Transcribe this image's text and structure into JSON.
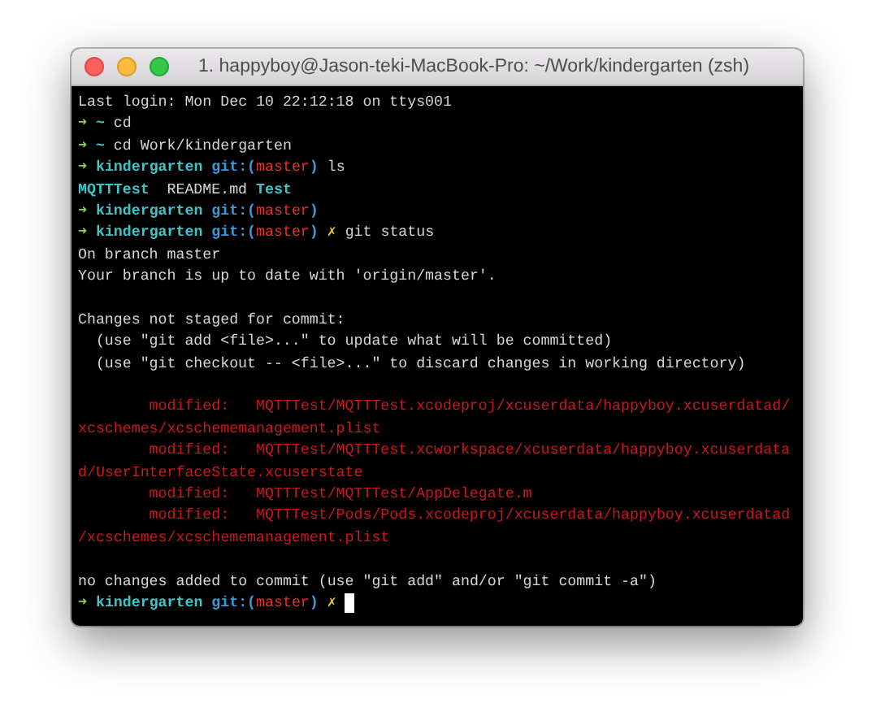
{
  "window": {
    "title": "1. happyboy@Jason-teki-MacBook-Pro: ~/Work/kindergarten (zsh)"
  },
  "lines": [
    {
      "kind": "text",
      "segments": [
        {
          "kind": "plain",
          "text": "Last login: Mon Dec 10 22:12:18 on ttys001"
        }
      ]
    },
    {
      "kind": "text",
      "segments": [
        {
          "kind": "arrow",
          "text": "➜"
        },
        {
          "kind": "cwd",
          "text": "~"
        },
        {
          "kind": "plain",
          "text": "cd"
        }
      ]
    },
    {
      "kind": "text",
      "segments": [
        {
          "kind": "arrow",
          "text": "➜"
        },
        {
          "kind": "cwd",
          "text": "~"
        },
        {
          "kind": "plain",
          "text": "cd Work/kindergarten"
        }
      ]
    },
    {
      "kind": "text",
      "segments": [
        {
          "kind": "arrow",
          "text": "➜"
        },
        {
          "kind": "cwd",
          "text": "kindergarten"
        },
        {
          "kind": "git",
          "text": "git:("
        },
        {
          "kind": "branch",
          "text": "master"
        },
        {
          "kind": "git-close",
          "text": ")"
        },
        {
          "kind": "plain",
          "text": "ls"
        }
      ]
    },
    {
      "kind": "text",
      "segments": [
        {
          "kind": "dir",
          "text": "MQTTTest"
        },
        {
          "kind": "spaced",
          "text": "README.md"
        },
        {
          "kind": "dir",
          "text": "Test"
        }
      ]
    },
    {
      "kind": "text",
      "segments": [
        {
          "kind": "arrow",
          "text": "➜"
        },
        {
          "kind": "cwd",
          "text": "kindergarten"
        },
        {
          "kind": "git",
          "text": "git:("
        },
        {
          "kind": "branch",
          "text": "master"
        },
        {
          "kind": "git-close",
          "text": ")"
        }
      ]
    },
    {
      "kind": "text",
      "segments": [
        {
          "kind": "arrow",
          "text": "➜"
        },
        {
          "kind": "cwd",
          "text": "kindergarten"
        },
        {
          "kind": "git",
          "text": "git:("
        },
        {
          "kind": "branch",
          "text": "master"
        },
        {
          "kind": "git-close",
          "text": ")"
        },
        {
          "kind": "dirty",
          "text": "✗"
        },
        {
          "kind": "plain",
          "text": "git status"
        }
      ]
    },
    {
      "kind": "text",
      "segments": [
        {
          "kind": "plain",
          "text": "On branch master"
        }
      ]
    },
    {
      "kind": "text",
      "segments": [
        {
          "kind": "plain",
          "text": "Your branch is up to date with 'origin/master'."
        }
      ]
    },
    {
      "kind": "blank"
    },
    {
      "kind": "text",
      "segments": [
        {
          "kind": "plain",
          "text": "Changes not staged for commit:"
        }
      ]
    },
    {
      "kind": "text",
      "segments": [
        {
          "kind": "hint",
          "text": "(use \"git add <file>...\" to update what will be committed)"
        }
      ]
    },
    {
      "kind": "text",
      "segments": [
        {
          "kind": "hint",
          "text": "(use \"git checkout -- <file>...\" to discard changes in working directory)"
        }
      ]
    },
    {
      "kind": "blank"
    },
    {
      "kind": "text",
      "segments": [
        {
          "kind": "modified-label",
          "text": "modified:"
        },
        {
          "kind": "modified-path",
          "text": "MQTTTest/MQTTTest.xcodeproj/xcuserdata/happyboy.xcuserdatad/"
        }
      ]
    },
    {
      "kind": "text",
      "segments": [
        {
          "kind": "modified-wrap",
          "text": "xcschemes/xcschememanagement.plist"
        }
      ]
    },
    {
      "kind": "text",
      "segments": [
        {
          "kind": "modified-label",
          "text": "modified:"
        },
        {
          "kind": "modified-path",
          "text": "MQTTTest/MQTTTest.xcworkspace/xcuserdata/happyboy.xcuserdata"
        }
      ]
    },
    {
      "kind": "text",
      "segments": [
        {
          "kind": "modified-wrap",
          "text": "d/UserInterfaceState.xcuserstate"
        }
      ]
    },
    {
      "kind": "text",
      "segments": [
        {
          "kind": "modified-label",
          "text": "modified:"
        },
        {
          "kind": "modified-path",
          "text": "MQTTTest/MQTTTest/AppDelegate.m"
        }
      ]
    },
    {
      "kind": "text",
      "segments": [
        {
          "kind": "modified-label",
          "text": "modified:"
        },
        {
          "kind": "modified-path",
          "text": "MQTTTest/Pods/Pods.xcodeproj/xcuserdata/happyboy.xcuserdatad"
        }
      ]
    },
    {
      "kind": "text",
      "segments": [
        {
          "kind": "modified-wrap",
          "text": "/xcschemes/xcschememanagement.plist"
        }
      ]
    },
    {
      "kind": "blank"
    },
    {
      "kind": "text",
      "segments": [
        {
          "kind": "plain",
          "text": "no changes added to commit (use \"git add\" and/or \"git commit -a\")"
        }
      ]
    },
    {
      "kind": "text",
      "segments": [
        {
          "kind": "arrow",
          "text": "➜"
        },
        {
          "kind": "cwd",
          "text": "kindergarten"
        },
        {
          "kind": "git",
          "text": "git:("
        },
        {
          "kind": "branch",
          "text": "master"
        },
        {
          "kind": "git-close",
          "text": ")"
        },
        {
          "kind": "dirty",
          "text": "✗"
        },
        {
          "kind": "cursor"
        }
      ]
    }
  ]
}
